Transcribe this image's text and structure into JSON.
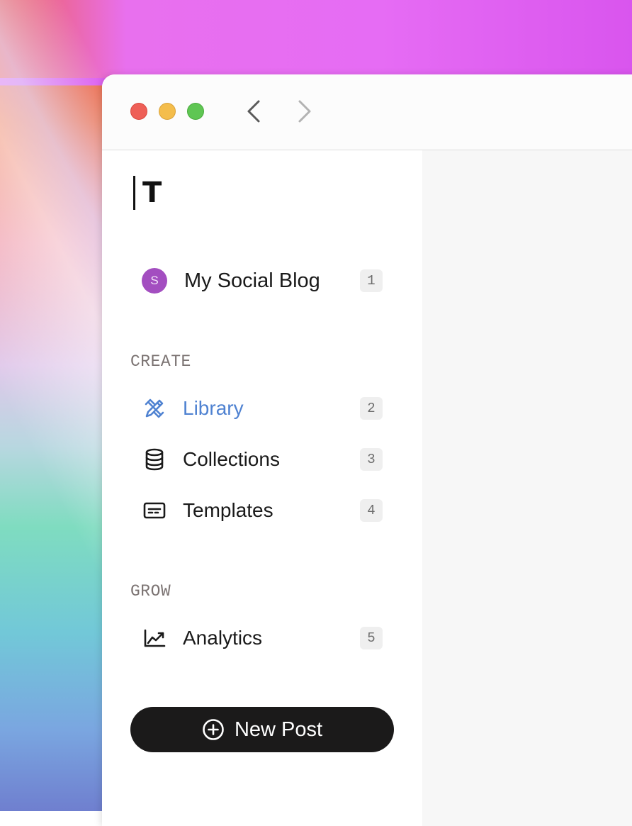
{
  "window": {
    "controls": [
      "close",
      "minimize",
      "zoom"
    ],
    "nav": {
      "back_icon": "chevron-left-icon",
      "forward_icon": "chevron-right-icon"
    }
  },
  "brand": {
    "logo_text": "T"
  },
  "workspace": {
    "avatar_letter": "S",
    "name": "My Social Blog",
    "shortcut": "1",
    "avatar_color": "#a34ec0"
  },
  "sections": {
    "create": {
      "title": "CREATE",
      "items": [
        {
          "label": "Library",
          "shortcut": "2",
          "icon": "design-tools-icon",
          "active": true
        },
        {
          "label": "Collections",
          "shortcut": "3",
          "icon": "database-icon",
          "active": false
        },
        {
          "label": "Templates",
          "shortcut": "4",
          "icon": "template-card-icon",
          "active": false
        }
      ]
    },
    "grow": {
      "title": "GROW",
      "items": [
        {
          "label": "Analytics",
          "shortcut": "5",
          "icon": "chart-line-icon",
          "active": false
        }
      ]
    }
  },
  "actions": {
    "new_post_label": "New Post",
    "new_post_icon": "plus-circle-icon"
  },
  "colors": {
    "accent": "#4f82d1",
    "button_bg": "#1b1a1a"
  }
}
